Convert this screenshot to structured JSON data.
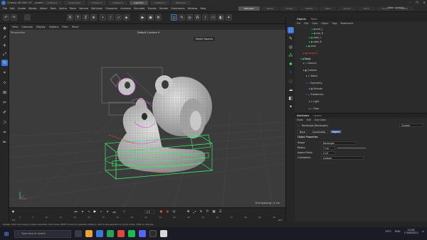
{
  "window": {
    "title": "Cinema 4D R26.107 - [snailmodel*] - Main",
    "tabs": [
      "Untitled 1",
      "snailmodel*",
      "Untitled 3",
      "Untitled 4",
      "snail-Trim",
      "Untitled 6",
      "sketches*"
    ],
    "controls": [
      "–",
      "❐",
      "✕"
    ]
  },
  "menubar": {
    "items": [
      "File",
      "Edit",
      "Create",
      "Modes",
      "Select",
      "Tools",
      "Spline",
      "Mesh",
      "Volume",
      "MoGraph",
      "Character",
      "Animate",
      "Simulate",
      "Tracker",
      "Render",
      "Extensions",
      "Window",
      "Help"
    ],
    "layouts": [
      "Standard",
      "Model",
      "Sculpt",
      "UVEdit",
      "Paint",
      "Groom",
      "Track",
      "Script",
      "Nodes"
    ],
    "active_layout": "Standard",
    "new_layouts": "New Layouts"
  },
  "viewport": {
    "menu": [
      "View",
      "Cameras",
      "Display",
      "Options",
      "Filter",
      "Panel"
    ],
    "label": "Perspective",
    "camera": "Default Camera ✳",
    "mode": "Model Spaces",
    "grid": "Grid Spacing : 5 cm"
  },
  "objects": {
    "tabs": [
      "Objects",
      "Takes"
    ],
    "menu": [
      "File",
      "Edit",
      "View",
      "Object",
      "Tags",
      "Bookmarks"
    ],
    "rows": [
      "eye_L",
      "eye_R",
      "stalk_L",
      "stalk_R",
      "shell",
      "Sphere.1",
      "Body",
      "Ground",
      "Camera",
      "Spline",
      "Symmetry",
      "Extrude",
      "Subdivision",
      "Light",
      "Floor"
    ]
  },
  "attributes": {
    "tabs": [
      "Attributes",
      "Layers"
    ],
    "menu": [
      "Mode",
      "Edit",
      "User Data"
    ],
    "object_name": "Rectangle [Rectangle]",
    "custom": "Custom",
    "subtabs": [
      "Basic",
      "Coordinates",
      "Object"
    ],
    "section": "Object Properties",
    "props": [
      {
        "label": "Shape",
        "value": "Rectangle"
      },
      {
        "label": "Radius",
        "value": "7 cm"
      },
      {
        "label": "Aspect Ratio",
        "value": "0.24"
      },
      {
        "label": "Orientation",
        "value": "Custom"
      }
    ]
  },
  "timeline": {
    "frame": "0 F",
    "start": "0 F",
    "end": "90 F",
    "ticks": [
      "0",
      "5",
      "10",
      "15",
      "20",
      "25",
      "30",
      "35",
      "40",
      "45",
      "50",
      "55",
      "60",
      "65",
      "70",
      "75",
      "80",
      "85",
      "90"
    ]
  },
  "status": "Rotate: Click and drag to rotate elements. Hold down SHIFT to add to quantize rotation / add to the selection in point mode, CTRL to remove.",
  "taskbar": {
    "search": "Type here to search",
    "weather": "19°C",
    "lang": "ENG",
    "time": "22:08",
    "date": "17/08/2022"
  },
  "colors": {
    "selection_green": "#3ee36a",
    "highlight_magenta": "#e23ee6",
    "accent_blue": "#3a77d8"
  }
}
